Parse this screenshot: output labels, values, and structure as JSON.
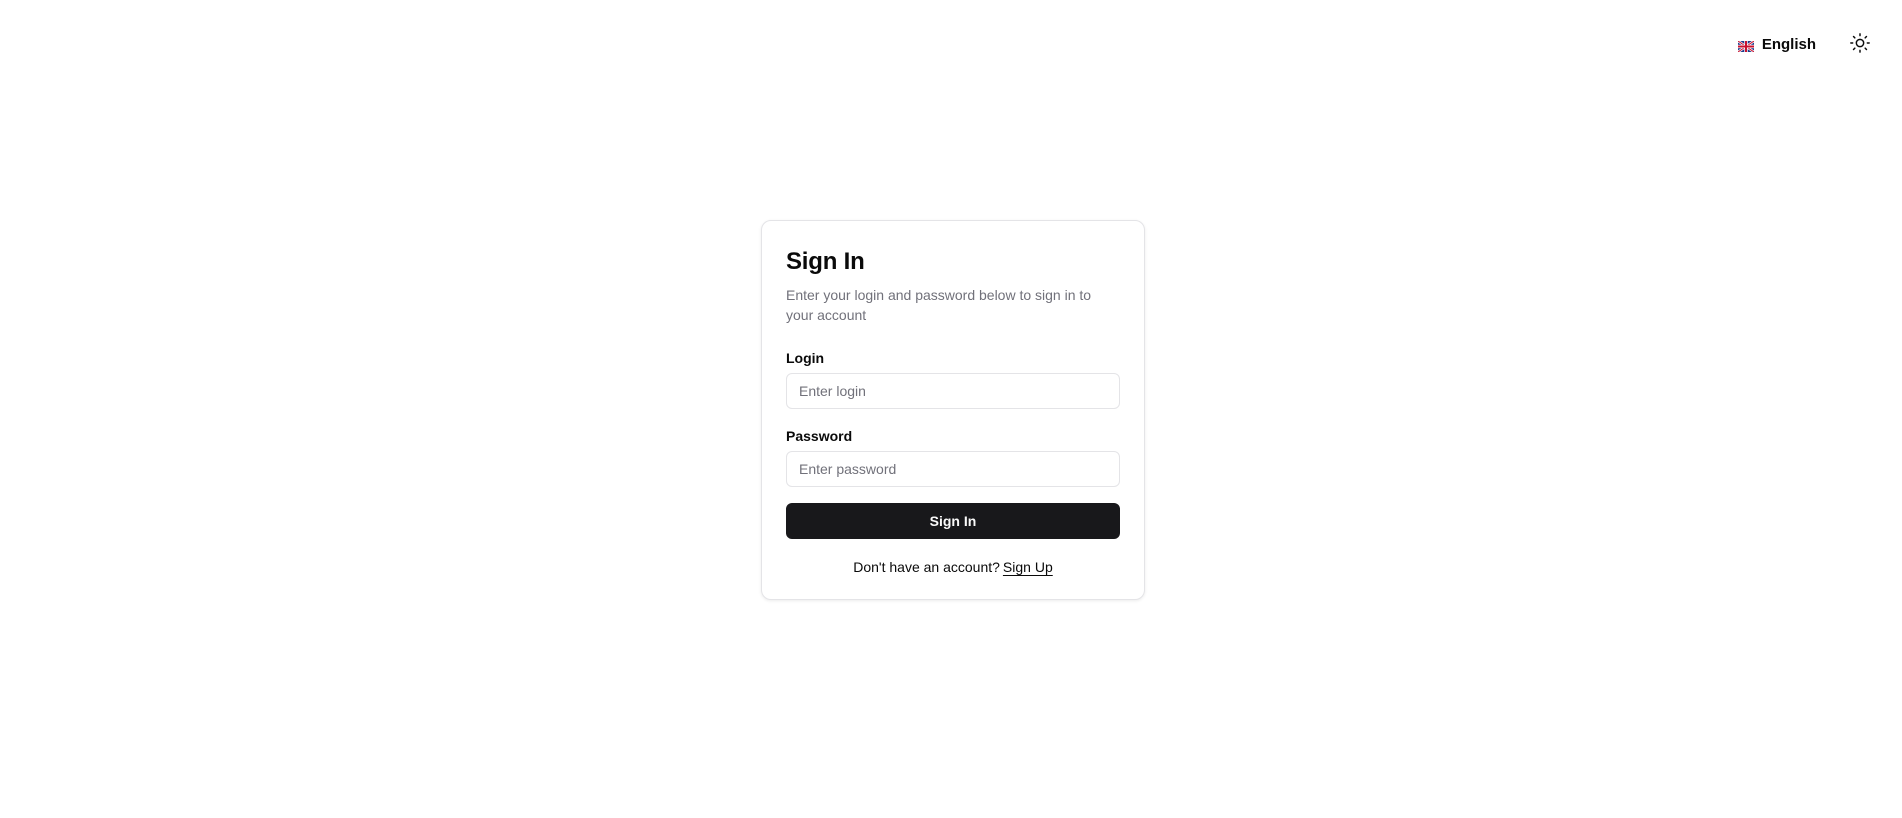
{
  "header": {
    "language": {
      "label": "English",
      "flag_icon": "uk-flag-icon"
    },
    "theme_toggle": {
      "icon": "sun-icon"
    }
  },
  "signin": {
    "title": "Sign In",
    "subtitle": "Enter your login and password below to sign in to your account",
    "login": {
      "label": "Login",
      "placeholder": "Enter login",
      "value": ""
    },
    "password": {
      "label": "Password",
      "placeholder": "Enter password",
      "value": ""
    },
    "submit_label": "Sign In",
    "footer": {
      "prompt": "Don't have an account?",
      "link_label": "Sign Up"
    }
  },
  "colors": {
    "primary_button": "#18181b",
    "muted_text": "#71717a",
    "border": "#e4e4e7"
  }
}
